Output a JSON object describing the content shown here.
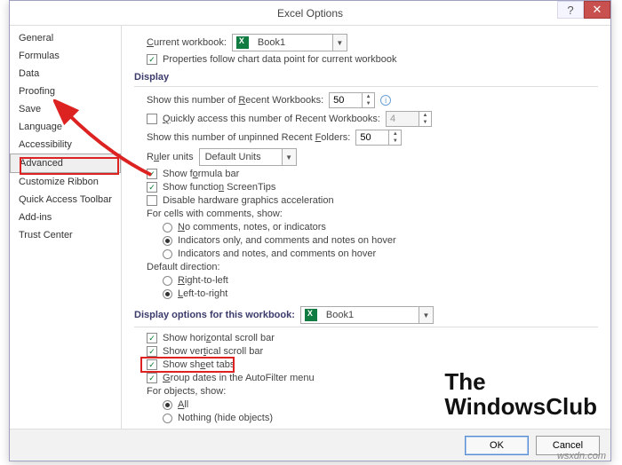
{
  "window": {
    "title": "Excel Options",
    "help": "?",
    "close": "✕"
  },
  "sidebar": {
    "items": [
      {
        "label": "General"
      },
      {
        "label": "Formulas"
      },
      {
        "label": "Data"
      },
      {
        "label": "Proofing"
      },
      {
        "label": "Save"
      },
      {
        "label": "Language"
      },
      {
        "label": "Accessibility"
      },
      {
        "label": "Advanced",
        "active": true
      },
      {
        "label": "Customize Ribbon"
      },
      {
        "label": "Quick Access Toolbar"
      },
      {
        "label": "Add-ins"
      },
      {
        "label": "Trust Center"
      }
    ]
  },
  "main": {
    "current_workbook_label": "Current workbook:",
    "current_workbook_value": "Book1",
    "prop_follow": "Properties follow chart data point for current workbook",
    "display_header": "Display",
    "recent_wb_label": "Show this number of Recent Workbooks:",
    "recent_wb_value": "50",
    "quick_access_label": "Quickly access this number of Recent Workbooks:",
    "quick_access_value": "4",
    "recent_folders_label": "Show this number of unpinned Recent Folders:",
    "recent_folders_value": "50",
    "ruler_label": "Ruler units",
    "ruler_value": "Default Units",
    "show_formula": "Show formula bar",
    "show_tips": "Show function ScreenTips",
    "disable_hw": "Disable hardware graphics acceleration",
    "comments_header": "For cells with comments, show:",
    "comments_opt1": "No comments, notes, or indicators",
    "comments_opt2": "Indicators only, and comments and notes on hover",
    "comments_opt3": "Indicators and notes, and comments on hover",
    "dir_header": "Default direction:",
    "dir_rtl": "Right-to-left",
    "dir_ltr": "Left-to-right",
    "disp_wb_header": "Display options for this workbook:",
    "disp_wb_value": "Book1",
    "hscroll": "Show horizontal scroll bar",
    "vscroll": "Show vertical scroll bar",
    "sheet_tabs": "Show sheet tabs",
    "group_dates": "Group dates in the AutoFilter menu",
    "objects_header": "For objects, show:",
    "obj_all": "All",
    "obj_none": "Nothing (hide objects)"
  },
  "footer": {
    "ok": "OK",
    "cancel": "Cancel"
  },
  "watermark": {
    "line1": "The",
    "line2": "WindowsClub",
    "url": "wsxdn.com"
  }
}
